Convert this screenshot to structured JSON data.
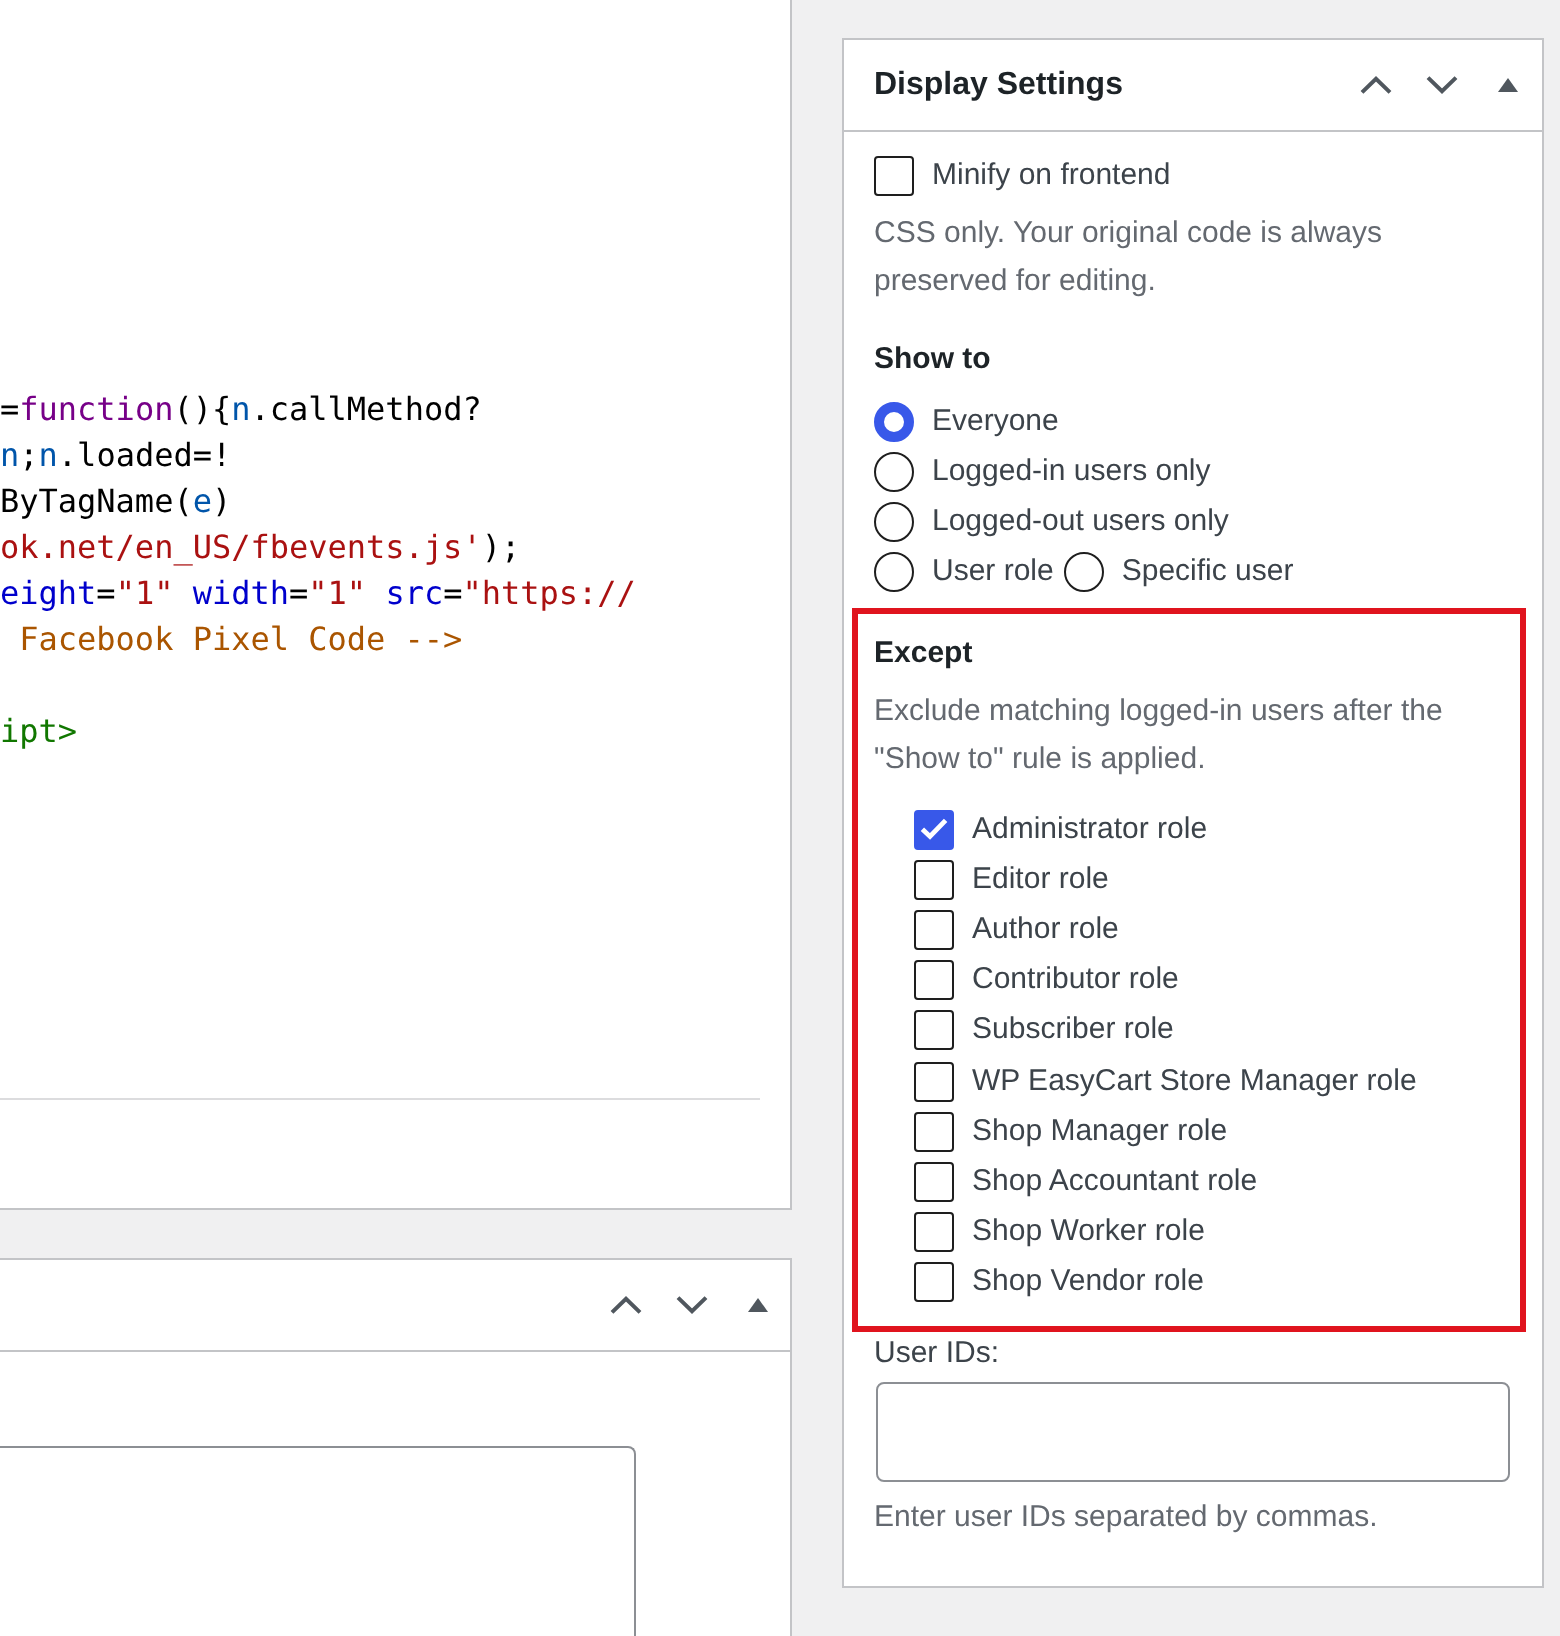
{
  "code_editor": {
    "lines": [
      {
        "kind": "code",
        "tokens": [
          {
            "text": "=",
            "kind": "plain"
          },
          {
            "text": "function",
            "kind": "keyword"
          },
          {
            "text": "(){",
            "kind": "plain"
          },
          {
            "text": "n",
            "kind": "variable"
          },
          {
            "text": ".callMethod?",
            "kind": "plain"
          }
        ]
      },
      {
        "kind": "code",
        "tokens": [
          {
            "text": "n",
            "kind": "variable"
          },
          {
            "text": ";",
            "kind": "plain"
          },
          {
            "text": "n",
            "kind": "variable"
          },
          {
            "text": ".loaded=!",
            "kind": "plain"
          }
        ]
      },
      {
        "kind": "code",
        "tokens": [
          {
            "text": "ByTagName(",
            "kind": "plain"
          },
          {
            "text": "e",
            "kind": "variable"
          },
          {
            "text": ")",
            "kind": "plain"
          }
        ]
      },
      {
        "kind": "code",
        "tokens": [
          {
            "text": "ok.net/en_US/fbevents.js'",
            "kind": "string"
          },
          {
            "text": ");",
            "kind": "plain"
          }
        ]
      },
      {
        "kind": "code",
        "tokens": [
          {
            "text": "eight",
            "kind": "attribute"
          },
          {
            "text": "=",
            "kind": "plain"
          },
          {
            "text": "\"1\" ",
            "kind": "string"
          },
          {
            "text": "width",
            "kind": "attribute"
          },
          {
            "text": "=",
            "kind": "plain"
          },
          {
            "text": "\"1\" ",
            "kind": "string"
          },
          {
            "text": "src",
            "kind": "attribute"
          },
          {
            "text": "=",
            "kind": "plain"
          },
          {
            "text": "\"https://",
            "kind": "string"
          }
        ]
      },
      {
        "kind": "code",
        "tokens": [
          {
            "text": " Facebook Pixel Code -->",
            "kind": "comment"
          }
        ]
      },
      {
        "kind": "blank"
      },
      {
        "kind": "code",
        "tokens": [
          {
            "text": "ipt>",
            "kind": "tag"
          }
        ]
      }
    ]
  },
  "display_settings": {
    "title": "Display Settings",
    "minify": {
      "label": "Minify on frontend",
      "checked": false,
      "help": "CSS only. Your original code is always preserved for editing."
    },
    "show_to": {
      "label": "Show to",
      "rows": [
        {
          "options": [
            {
              "label": "Everyone",
              "selected": true
            }
          ]
        },
        {
          "options": [
            {
              "label": "Logged-in users only",
              "selected": false
            }
          ]
        },
        {
          "options": [
            {
              "label": "Logged-out users only",
              "selected": false
            }
          ]
        },
        {
          "options": [
            {
              "label": "User role",
              "selected": false
            },
            {
              "label": "Specific user",
              "selected": false
            }
          ]
        }
      ]
    },
    "except": {
      "highlighted": true,
      "title": "Except",
      "description": "Exclude matching logged-in users after the \"Show to\" rule is applied.",
      "roles": [
        {
          "label": "Administrator role",
          "checked": true
        },
        {
          "label": "Editor role",
          "checked": false
        },
        {
          "label": "Author role",
          "checked": false
        },
        {
          "label": "Contributor role",
          "checked": false
        },
        {
          "label": "Subscriber role",
          "checked": false
        },
        {
          "label": "WP EasyCart Store Manager role",
          "checked": false
        },
        {
          "label": "Shop Manager role",
          "checked": false
        },
        {
          "label": "Shop Accountant role",
          "checked": false
        },
        {
          "label": "Shop Worker role",
          "checked": false
        },
        {
          "label": "Shop Vendor role",
          "checked": false
        }
      ]
    },
    "user_ids": {
      "label": "User IDs:",
      "help": "Enter user IDs separated by commas."
    }
  }
}
